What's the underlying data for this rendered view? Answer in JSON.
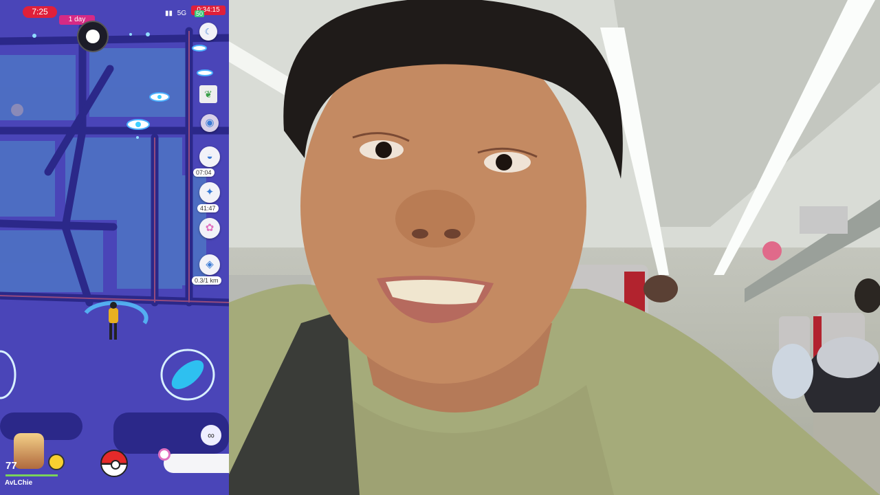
{
  "status_bar": {
    "time": "7:25",
    "network": "5G",
    "battery_badge": "50",
    "timer": "0:34:15"
  },
  "map": {
    "event_pill": "1 day",
    "side_buttons": [
      {
        "icon": "raid-egg-icon",
        "label": "07:04"
      },
      {
        "icon": "rocket-icon",
        "label": "41:47"
      },
      {
        "icon": "lure-icon",
        "label": ""
      },
      {
        "icon": "route-icon",
        "label": "0.3/1 km"
      }
    ],
    "trainer": {
      "level": "77",
      "username": "AvLChie"
    }
  },
  "colors": {
    "map_background": "#4a45b8",
    "road": "#2c2a8a",
    "block": "#3f5cba",
    "accent_red": "#e0203a",
    "accent_pink": "#d62a85"
  }
}
